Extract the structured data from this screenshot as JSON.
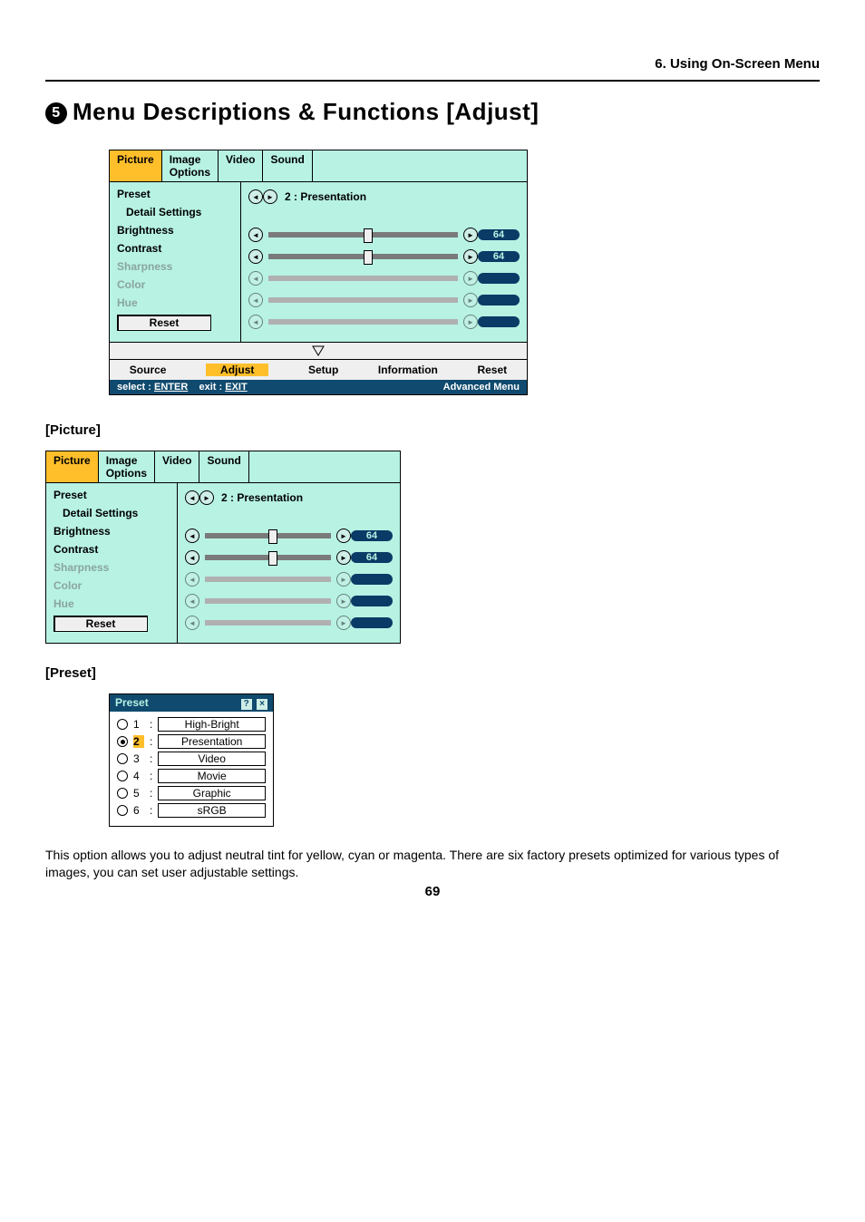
{
  "header_section": "6. Using On-Screen Menu",
  "title_num": "5",
  "title": "Menu Descriptions & Functions [Adjust]",
  "osd_a": {
    "tabs": [
      "Picture",
      "Image\nOptions",
      "Video",
      "Sound"
    ],
    "selected_tab": 0,
    "menu": {
      "preset": "Preset",
      "detail": "Detail Settings",
      "brightness": "Brightness",
      "contrast": "Contrast",
      "sharpness": "Sharpness",
      "color": "Color",
      "hue": "Hue",
      "reset": "Reset"
    },
    "preset_value": "2 : Presentation",
    "brightness_value": "64",
    "contrast_value": "64",
    "bottom": {
      "source": "Source",
      "adjust": "Adjust",
      "setup": "Setup",
      "information": "Information",
      "reset": "Reset"
    },
    "status": {
      "select": "select :",
      "select_btn": "ENTER",
      "exit": "exit :",
      "exit_btn": "EXIT",
      "adv": "Advanced Menu"
    }
  },
  "chart_data": {
    "type": "table",
    "title": "Picture settings",
    "rows": [
      {
        "item": "Preset",
        "value": "2 : Presentation",
        "enabled": true
      },
      {
        "item": "Brightness",
        "value": 64,
        "enabled": true
      },
      {
        "item": "Contrast",
        "value": 64,
        "enabled": true
      },
      {
        "item": "Sharpness",
        "value": null,
        "enabled": false
      },
      {
        "item": "Color",
        "value": null,
        "enabled": false
      },
      {
        "item": "Hue",
        "value": null,
        "enabled": false
      }
    ]
  },
  "sub_heading_picture": "[Picture]",
  "sub_heading_preset": "[Preset]",
  "preset_dialog": {
    "title": "Preset",
    "selected": 2,
    "options": [
      {
        "n": "1",
        "label": "High-Bright"
      },
      {
        "n": "2",
        "label": "Presentation"
      },
      {
        "n": "3",
        "label": "Video"
      },
      {
        "n": "4",
        "label": "Movie"
      },
      {
        "n": "5",
        "label": "Graphic"
      },
      {
        "n": "6",
        "label": "sRGB"
      }
    ]
  },
  "paragraph": "This option allows you to adjust neutral tint for yellow, cyan or magenta. There are six factory presets optimized for various types of images, you can set user adjustable settings.",
  "page_number": "69"
}
